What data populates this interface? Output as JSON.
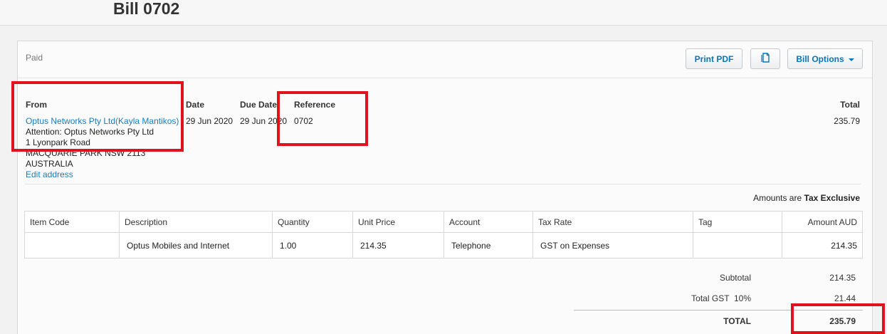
{
  "page": {
    "title": "Bill 0702"
  },
  "header": {
    "status": "Paid",
    "print_label": "Print PDF",
    "copy_icon": "copy-document-icon",
    "options_label": "Bill Options"
  },
  "bill": {
    "from_label": "From",
    "from_name": "Optus Networks Pty Ltd(Kayla Mantikos)",
    "attention": "Attention: Optus Networks Pty Ltd",
    "address_line1": "1 Lyonpark Road",
    "address_line2": "MACQUARIE PARK NSW 2113",
    "country": "AUSTRALIA",
    "edit_address": "Edit address",
    "date_label": "Date",
    "date": "29 Jun 2020",
    "due_date_label": "Due Date",
    "due_date": "29 Jun 2020",
    "reference_label": "Reference",
    "reference": "0702",
    "total_label": "Total",
    "total": "235.79",
    "amounts_prefix": "Amounts are",
    "amounts_mode": "Tax Exclusive"
  },
  "table": {
    "headers": [
      "Item Code",
      "Description",
      "Quantity",
      "Unit Price",
      "Account",
      "Tax Rate",
      "Tag",
      "Amount AUD"
    ],
    "rows": [
      [
        "",
        "Optus Mobiles and Internet",
        "1.00",
        "214.35",
        "Telephone",
        "GST on Expenses",
        "",
        "214.35"
      ]
    ]
  },
  "totals": {
    "subtotal_label": "Subtotal",
    "subtotal": "214.35",
    "gst_label": "Total GST  10%",
    "gst": "21.44",
    "total_label": "TOTAL",
    "total": "235.79"
  },
  "colors": {
    "link": "#1a7bbd",
    "highlight": "#e0121c",
    "button_text": "#0a76b8"
  }
}
